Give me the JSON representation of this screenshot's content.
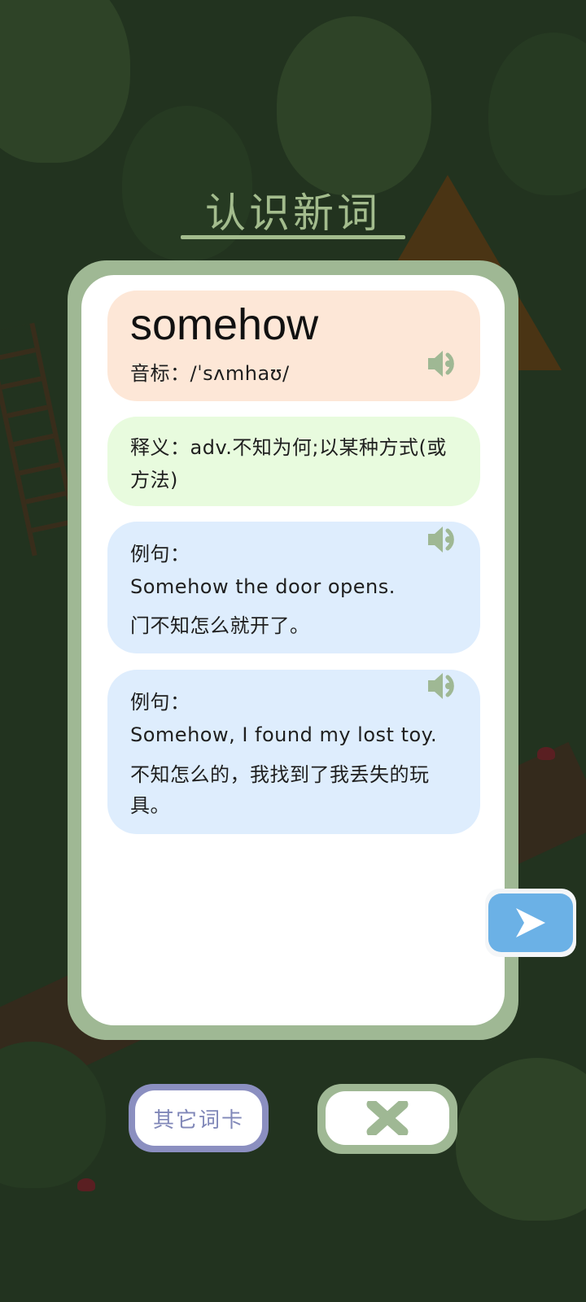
{
  "header": {
    "title": "认识新词"
  },
  "word_card": {
    "word": "somehow",
    "phonetic": "音标：/ˈsʌmhaʊ/",
    "meaning": "释义：adv.不知为何;以某种方式(或方法)"
  },
  "examples": [
    {
      "label": "例句：",
      "english": "Somehow the door opens.",
      "chinese": "门不知怎么就开了。"
    },
    {
      "label": "例句：",
      "english": "Somehow, I found my lost toy.",
      "chinese": "不知怎么的，我找到了我丢失的玩具。"
    }
  ],
  "buttons": {
    "other_cards": "其它词卡"
  },
  "icons": {
    "speaker": "speaker-icon",
    "next": "arrow-right-icon",
    "close": "close-icon"
  },
  "colors": {
    "frame_green": "#9fb894",
    "word_panel": "#fde7d7",
    "meaning_panel": "#e8fbde",
    "example_panel": "#deedfd",
    "next_blue": "#6bb1e6",
    "other_button_border": "#8b8fc0"
  }
}
